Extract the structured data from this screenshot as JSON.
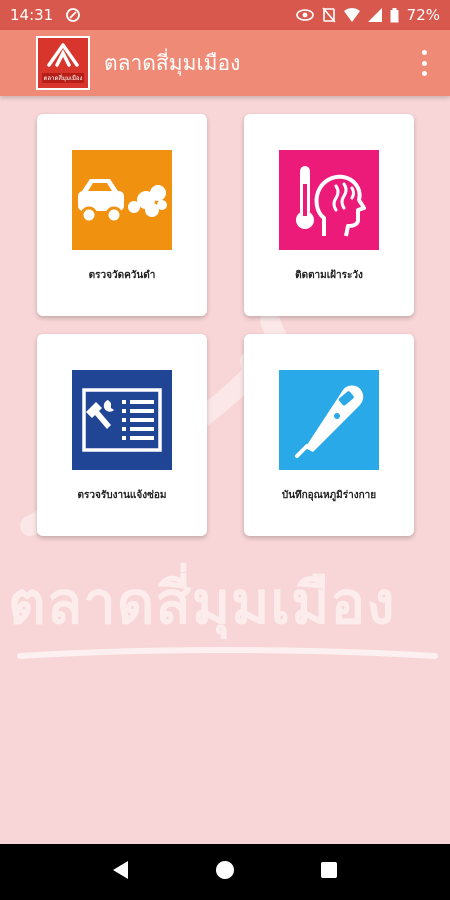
{
  "status_bar": {
    "time": "14:31",
    "battery": "72%"
  },
  "app_bar": {
    "title": "ตลาดสี่มุมเมือง",
    "logo_text": "ตลาดสี่มุมเมือง"
  },
  "menu": {
    "items": [
      {
        "label": "ตรวจวัดควันดำ",
        "icon": "truck-smoke-icon",
        "color": "#f0920f"
      },
      {
        "label": "ติดตามเฝ้าระวัง",
        "icon": "thermometer-head-icon",
        "color": "#ec1b7a"
      },
      {
        "label": "ตรวจรับงานแจ้งซ่อม",
        "icon": "repair-list-icon",
        "color": "#1f4594"
      },
      {
        "label": "บันทึกอุณหภูมิร่างกาย",
        "icon": "digital-thermometer-icon",
        "color": "#29a9e8"
      }
    ]
  },
  "watermark": {
    "text": "ตลาดสี่มุมเมือง"
  },
  "colors": {
    "status_bar": "#d9584e",
    "app_bar": "#ef8a76",
    "background": "#f8d5d6"
  }
}
